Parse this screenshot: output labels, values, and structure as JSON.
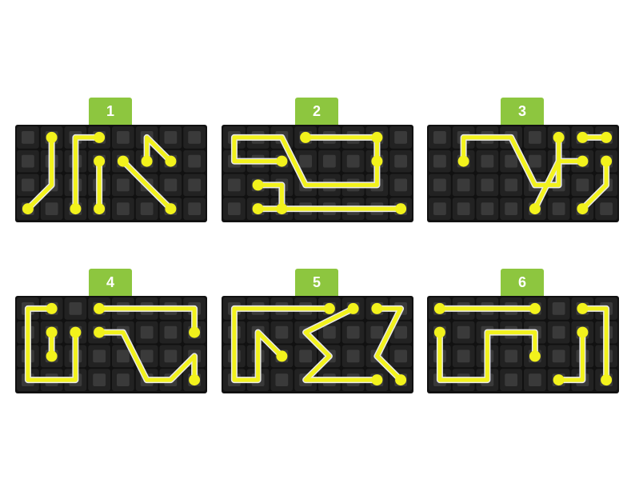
{
  "colors": {
    "background": "#ffffff",
    "tab": "#8dc63f",
    "tile": "#222222",
    "tile_inner": "#3a3a3a",
    "board_edge": "#111111",
    "path": "#f2f21c",
    "path_outline": "#e8e8e8"
  },
  "puzzles": [
    {
      "number": "1",
      "paths": [
        [
          [
            1,
            0
          ],
          [
            1,
            2
          ],
          [
            0,
            3
          ]
        ],
        [
          [
            3,
            0
          ],
          [
            2,
            0
          ],
          [
            2,
            3
          ]
        ],
        [
          [
            3,
            1
          ],
          [
            3,
            3
          ]
        ],
        [
          [
            4,
            1
          ],
          [
            5,
            2
          ],
          [
            6,
            3
          ]
        ],
        [
          [
            6,
            1
          ],
          [
            5,
            0
          ],
          [
            5,
            1
          ]
        ]
      ]
    },
    {
      "number": "2",
      "paths": [
        [
          [
            2,
            1
          ],
          [
            0,
            1
          ],
          [
            0,
            0
          ],
          [
            2,
            0
          ],
          [
            3,
            2
          ],
          [
            6,
            2
          ],
          [
            6,
            0
          ]
        ],
        [
          [
            3,
            0
          ],
          [
            6,
            0
          ],
          [
            6,
            1
          ]
        ],
        [
          [
            1,
            2
          ],
          [
            2,
            2
          ],
          [
            2,
            3
          ]
        ],
        [
          [
            1,
            3
          ],
          [
            7,
            3
          ]
        ]
      ]
    },
    {
      "number": "3",
      "paths": [
        [
          [
            1,
            1
          ],
          [
            1,
            0
          ],
          [
            3,
            0
          ],
          [
            4,
            2
          ],
          [
            5,
            2
          ],
          [
            5,
            0
          ]
        ],
        [
          [
            6,
            0
          ],
          [
            7,
            0
          ]
        ],
        [
          [
            6,
            1
          ],
          [
            5,
            1
          ],
          [
            4,
            3
          ]
        ],
        [
          [
            6,
            3
          ],
          [
            7,
            2
          ],
          [
            7,
            1
          ]
        ]
      ]
    },
    {
      "number": "4",
      "paths": [
        [
          [
            1,
            0
          ],
          [
            0,
            0
          ],
          [
            0,
            3
          ],
          [
            2,
            3
          ],
          [
            2,
            1
          ]
        ],
        [
          [
            3,
            0
          ],
          [
            7,
            0
          ],
          [
            7,
            1
          ]
        ],
        [
          [
            1,
            1
          ],
          [
            1,
            2
          ]
        ],
        [
          [
            3,
            1
          ],
          [
            4,
            1
          ],
          [
            5,
            3
          ],
          [
            6,
            3
          ],
          [
            7,
            2
          ],
          [
            7,
            3
          ]
        ]
      ]
    },
    {
      "number": "5",
      "paths": [
        [
          [
            4,
            0
          ],
          [
            0,
            0
          ],
          [
            0,
            3
          ],
          [
            1,
            3
          ],
          [
            1,
            1
          ],
          [
            2,
            2
          ]
        ],
        [
          [
            5,
            0
          ],
          [
            3,
            1
          ],
          [
            4,
            2
          ],
          [
            3,
            3
          ],
          [
            6,
            3
          ]
        ],
        [
          [
            6,
            0
          ],
          [
            7,
            0
          ],
          [
            6,
            2
          ],
          [
            7,
            3
          ]
        ]
      ]
    },
    {
      "number": "6",
      "paths": [
        [
          [
            0,
            0
          ],
          [
            4,
            0
          ]
        ],
        [
          [
            0,
            1
          ],
          [
            0,
            3
          ],
          [
            2,
            3
          ],
          [
            2,
            1
          ],
          [
            4,
            1
          ],
          [
            4,
            2
          ]
        ],
        [
          [
            6,
            0
          ],
          [
            7,
            0
          ],
          [
            7,
            3
          ]
        ],
        [
          [
            5,
            3
          ],
          [
            6,
            3
          ],
          [
            6,
            1
          ]
        ]
      ]
    }
  ]
}
